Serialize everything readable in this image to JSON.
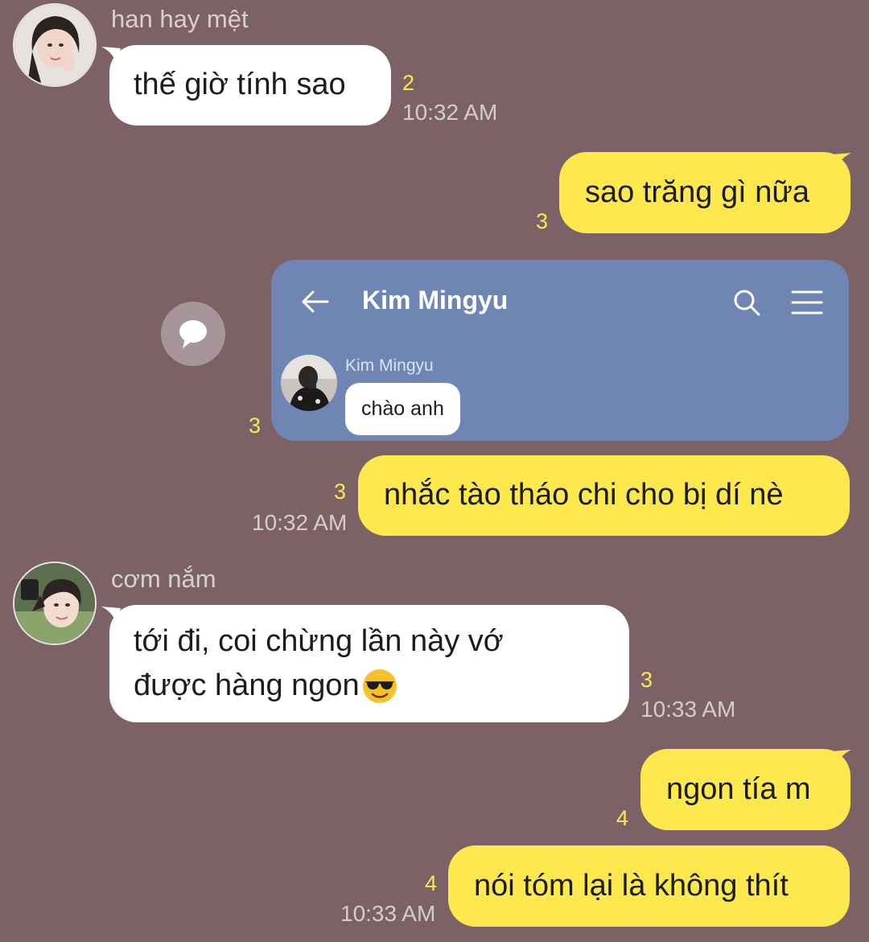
{
  "messages": [
    {
      "sender": "han hay mệt",
      "text": "thế giờ tính sao",
      "count": "2",
      "time": "10:32 AM"
    },
    {
      "text": "sao trăng gì nữa",
      "count": "3"
    },
    {
      "shared_card": {
        "title": "Kim Mingyu",
        "sender": "Kim Mingyu",
        "text": "chào anh"
      },
      "count": "3"
    },
    {
      "text": "nhắc tào tháo chi cho bị dí nè",
      "count": "3",
      "time": "10:32 AM"
    },
    {
      "sender": "cơm nắm",
      "line1": "tới đi, coi chừng lần này vớ",
      "line2": "được hàng ngon",
      "emoji": "😎",
      "count": "3",
      "time": "10:33 AM"
    },
    {
      "text": "ngon tía m",
      "count": "4"
    },
    {
      "text": "nói tóm lại là không thít",
      "count": "4",
      "time": "10:33 AM"
    }
  ],
  "icons": [
    "avatar",
    "back-arrow-icon",
    "search-icon",
    "menu-icon",
    "share-icon",
    "sunglasses-emoji-icon"
  ],
  "colors": {
    "background": "#7c6267",
    "outgoing_bubble": "#fde94e",
    "incoming_bubble": "#ffffff",
    "unread_count": "#fde94e",
    "card": "#6f86b5"
  }
}
